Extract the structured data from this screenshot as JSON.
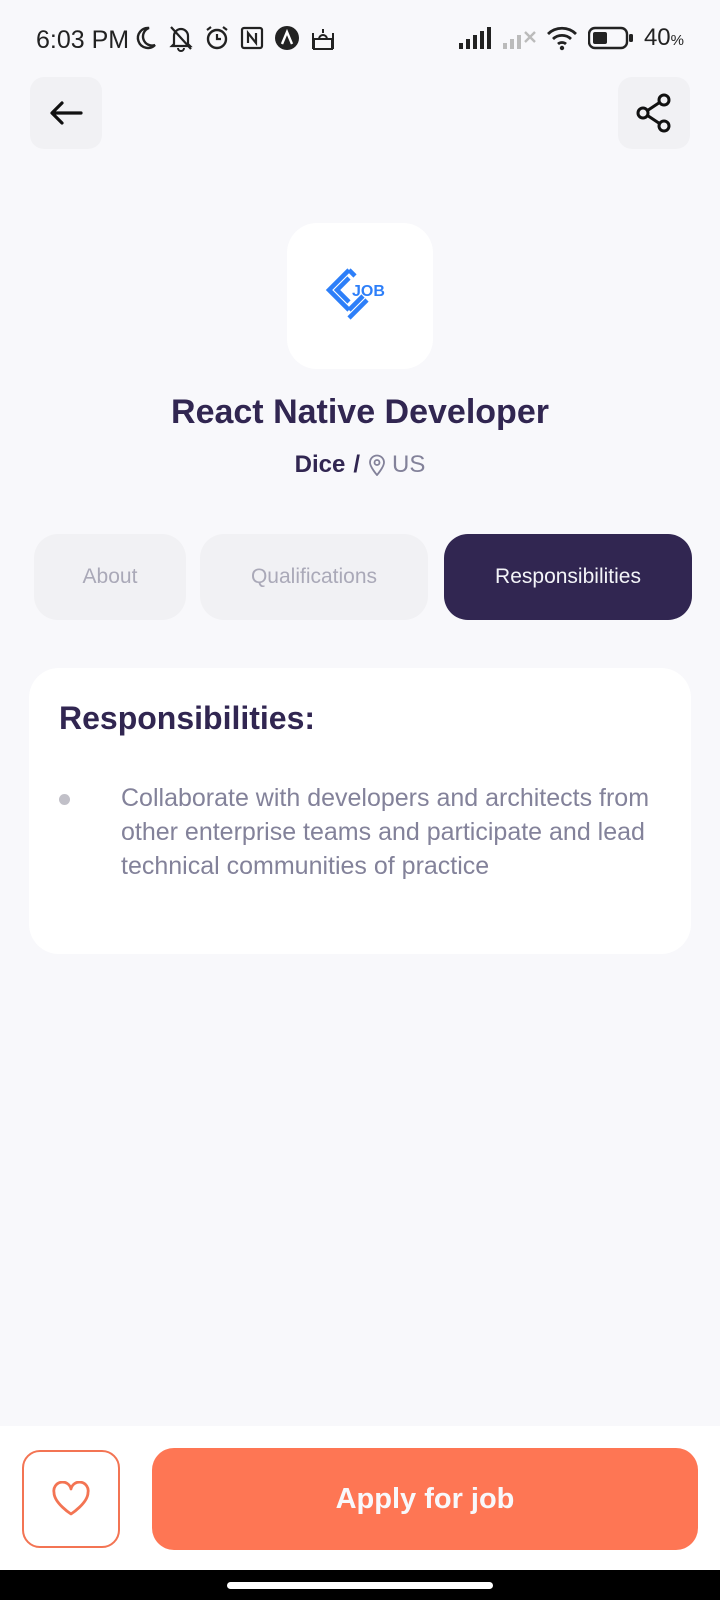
{
  "status_bar": {
    "time": "6:03 PM",
    "battery_percent": "40",
    "battery_unit": "%",
    "left_icons": [
      "moon-icon",
      "bell-off-icon",
      "alarm-icon",
      "nfc-icon",
      "app-a-icon",
      "mosque-icon"
    ],
    "right_icons": [
      "signal-icon",
      "signal-no-icon",
      "wifi-icon",
      "battery-icon"
    ]
  },
  "header": {
    "back_icon": "arrow-left-icon",
    "share_icon": "share-icon"
  },
  "job": {
    "logo_text": "JOB",
    "title": "React Native Developer",
    "company": "Dice",
    "separator": "/",
    "location": "US"
  },
  "tabs": [
    {
      "label": "About",
      "active": false
    },
    {
      "label": "Qualifications",
      "active": false
    },
    {
      "label": "Responsibilities",
      "active": true
    }
  ],
  "content": {
    "heading": "Responsibilities:",
    "points": [
      "Collaborate with developers and architects from other enterprise teams and participate and lead technical communities of practice"
    ]
  },
  "footer": {
    "favorite_icon": "heart-icon",
    "apply_label": "Apply for job"
  },
  "colors": {
    "primary": "#312651",
    "accent": "#FE7654",
    "gray": "#83829A",
    "background": "#F8F8FB",
    "logo_blue": "#2D7FF9"
  }
}
